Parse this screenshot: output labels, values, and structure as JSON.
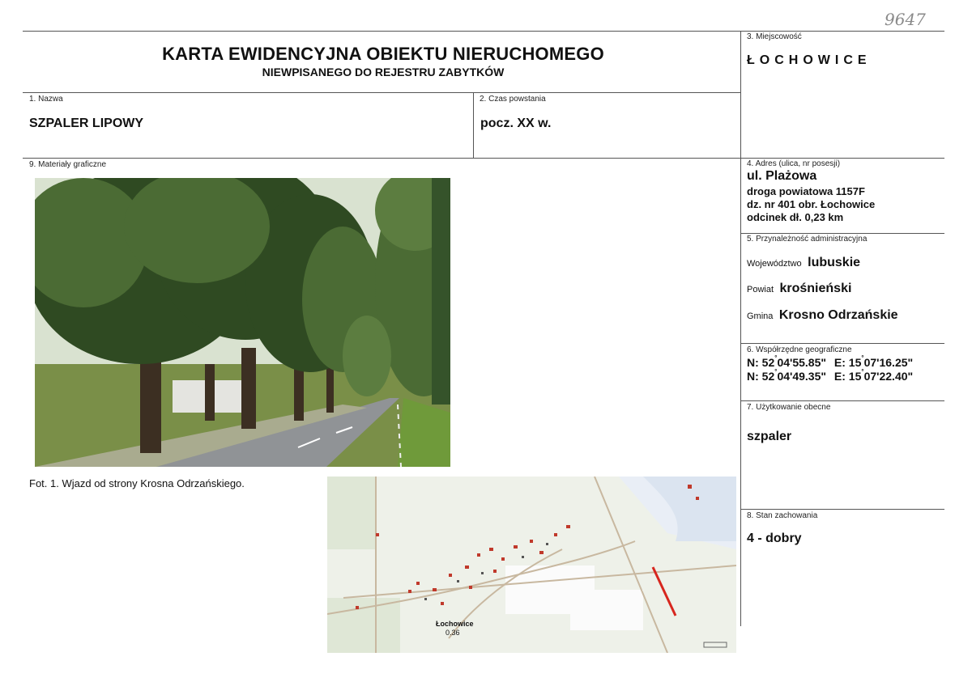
{
  "archive_number": "9647",
  "title": "KARTA EWIDENCYJNA OBIEKTU NIERUCHOMEGO",
  "subtitle": "NIEWPISANEGO DO REJESTRU ZABYTKÓW",
  "fields": {
    "miejscowosc": {
      "label": "3. Miejscowość",
      "value": "ŁOCHOWICE"
    },
    "nazwa": {
      "label": "1. Nazwa",
      "value": "SZPALER LIPOWY"
    },
    "czas": {
      "label": "2. Czas powstania",
      "value": "pocz. XX w."
    },
    "materialy": {
      "label": "9. Materiały graficzne"
    },
    "adres": {
      "label": "4. Adres (ulica, nr posesji)",
      "line1": "ul. Plażowa",
      "line2": "droga powiatowa 1157F",
      "line3": "dz. nr 401 obr. Łochowice",
      "line4": "odcinek dł. 0,23 km"
    },
    "przynaleznosc": {
      "label": "5. Przynależność administracyjna",
      "wojewodztwo_key": "Województwo",
      "wojewodztwo": "lubuskie",
      "powiat_key": "Powiat",
      "powiat": "krośnieński",
      "gmina_key": "Gmina",
      "gmina": "Krosno Odrzańskie"
    },
    "wspolrzedne": {
      "label": "6. Współrzędne geograficzne",
      "n1_lead": "N: 52",
      "n1_rest": "04'55.85\"",
      "e1_lead": "E: 15",
      "e1_rest": "07'16.25\"",
      "n2_lead": "N: 52",
      "n2_rest": "04'49.35\"",
      "e2_lead": "E: 15",
      "e2_rest": "07'22.40\"",
      "deg": "°"
    },
    "uzytkowanie": {
      "label": "7. Użytkowanie obecne",
      "value": "szpaler"
    },
    "stan": {
      "label": "8. Stan zachowania",
      "value": "4 - dobry"
    }
  },
  "photo_caption": "Fot. 1. Wjazd od strony Krosna Odrzańskiego.",
  "map": {
    "place_label": "Łochowice",
    "place_value": "0.36"
  },
  "colors": {
    "line": "#555555",
    "tree_dark": "#2f4a22",
    "tree_mid": "#4b6b34",
    "road": "#8a8d90",
    "map_house": "#c0392b",
    "map_road": "#c8b8a0",
    "map_lake": "#e9eef6",
    "highlight_segment": "#d7261e"
  }
}
